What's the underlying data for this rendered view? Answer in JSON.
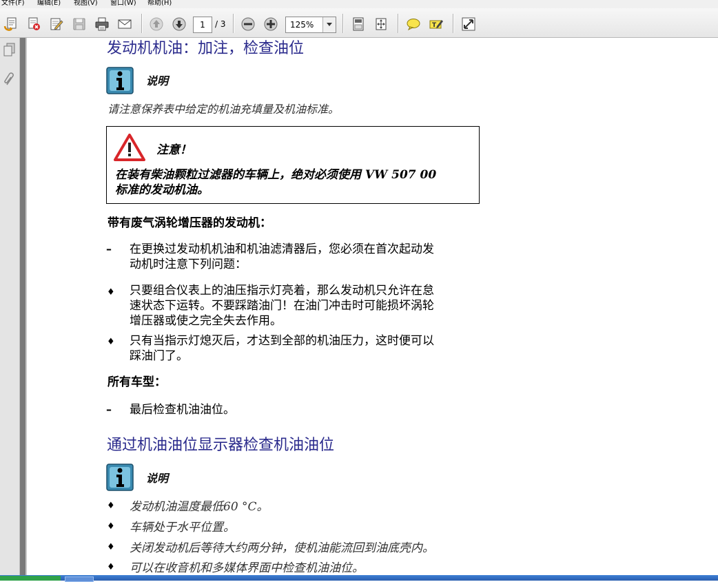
{
  "menu": {
    "file": "文件(F)",
    "edit": "编辑(E)",
    "view": "视图(V)",
    "window": "窗口(W)",
    "help": "帮助(H)"
  },
  "toolbar": {
    "page_current": "1",
    "page_total": "/ 3",
    "zoom": "125%"
  },
  "document": {
    "heading1": "发动机机油：加注，检查油位",
    "note1_title": "说明",
    "note1_text": "请注意保养表中给定的机油充填量及机油标准。",
    "caution_title": "注意！",
    "caution_line1": "在装有柴油颗粒过滤器的车辆上，绝对必须使用 VW 507 00",
    "caution_line2": "标准的发动机油。",
    "turbo_label": "带有废气涡轮增压器的发动机：",
    "dash_item1_line1": "在更换过发动机机油和机油滤清器后，您必须在首次起动发",
    "dash_item1_line2": "动机时注意下列问题：",
    "bullet1_line1": "只要组合仪表上的油压指示灯亮着，那么发动机只允许在怠",
    "bullet1_line2": "速状态下运转。不要踩踏油门！在油门冲击时可能损坏涡轮",
    "bullet1_line3": "增压器或使之完全失去作用。",
    "bullet2_line1": "只有当指示灯熄灭后，才达到全部的机油压力，这时便可以",
    "bullet2_line2": "踩油门了。",
    "all_models_label": "所有车型：",
    "dash_item2": "最后检查机油油位。",
    "heading2": "通过机油油位显示器检查机油油位",
    "note2_title": "说明",
    "note2_items": [
      "发动机油温度最低60 °C。",
      "车辆处于水平位置。",
      "关闭发动机后等待大约两分钟，使机油能流回到油底壳内。",
      "可以在收音机和多媒体界面中检查机油油位。"
    ]
  },
  "colors": {
    "heading": "#2a2a8c",
    "toolbar_bg": "#eeeeee",
    "nav_gutter": "#7a7a7a",
    "taskbar": "#2b5fb0"
  },
  "icons": [
    "create-pdf-icon",
    "attach-icon",
    "edit-icon",
    "save-icon",
    "print-icon",
    "email-icon",
    "page-up-icon",
    "page-down-icon",
    "zoom-out-icon",
    "zoom-in-icon",
    "fit-page-icon",
    "fit-width-icon",
    "comment-icon",
    "highlight-icon",
    "fullscreen-icon",
    "pages-panel-icon",
    "attachments-panel-icon",
    "info-icon",
    "warning-icon"
  ]
}
